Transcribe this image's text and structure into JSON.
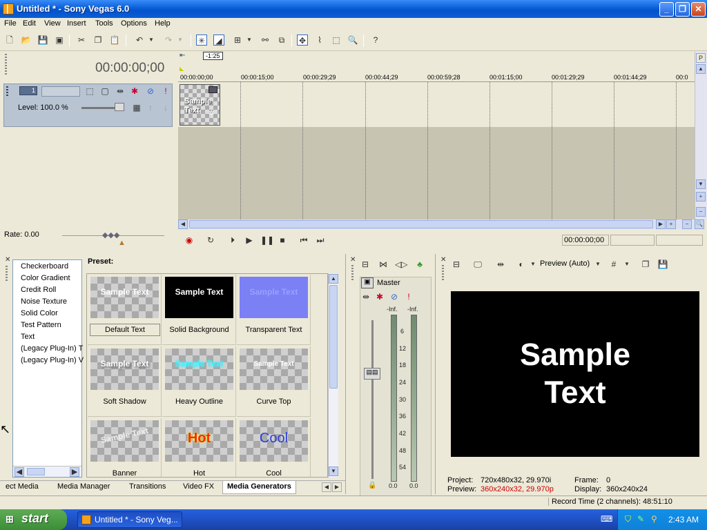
{
  "window": {
    "title": "Untitled * - Sony Vegas 6.0",
    "min": "_",
    "max": "❐",
    "close": "✕"
  },
  "menu": [
    "File",
    "Edit",
    "View",
    "Insert",
    "Tools",
    "Options",
    "Help"
  ],
  "cursor_time": "00:00:00;00",
  "ruler_marker": "-1:25",
  "ruler_labels": [
    "00:00:00;00",
    "00:00:15;00",
    "00:00:29;29",
    "00:00:44;29",
    "00:00:59;28",
    "00:01:15;00",
    "00:01:29;29",
    "00:01:44;29",
    "00:0"
  ],
  "track": {
    "number": "1",
    "level": "Level: 100.0 %"
  },
  "clip": {
    "text_line1": "Sample",
    "text_line2": "Text"
  },
  "rate": "Rate: 0.00",
  "transport": {
    "time": "00:00:00;00"
  },
  "generators": [
    "Checkerboard",
    "Color Gradient",
    "Credit Roll",
    "Noise Texture",
    "Solid Color",
    "Test Pattern",
    "Text",
    "(Legacy Plug-In) T",
    "(Legacy Plug-In) V"
  ],
  "preset_label": "Preset:",
  "presets": [
    {
      "label": "Default Text",
      "thumb": "Sample Text",
      "style": "checker",
      "color": "#ffffff"
    },
    {
      "label": "Solid Background",
      "thumb": "Sample Text",
      "style": "black",
      "color": "#ffffff"
    },
    {
      "label": "Transparent Text",
      "thumb": "Sample Text",
      "style": "purple",
      "color": "#9aa0ff"
    },
    {
      "label": "Soft Shadow",
      "thumb": "Sample Text",
      "style": "checker",
      "color": "#ffffff"
    },
    {
      "label": "Heavy Outline",
      "thumb": "Sample Text",
      "style": "checker",
      "color": "#3ff2ff"
    },
    {
      "label": "Curve Top",
      "thumb": "Sample Text",
      "style": "checker",
      "color": "#ffffff"
    },
    {
      "label": "Banner",
      "thumb": "Sample Text",
      "style": "checker",
      "color": "#eeeeee"
    },
    {
      "label": "Hot",
      "thumb": "Hot",
      "style": "checker",
      "color": "#ff2a00"
    },
    {
      "label": "Cool",
      "thumb": "Cool",
      "style": "checker",
      "color": "#2b3fd6"
    }
  ],
  "tabs": [
    "ect Media",
    "Media Manager",
    "Transitions",
    "Video FX",
    "Media Generators"
  ],
  "mixer": {
    "label": "Master",
    "inf_left": "-Inf.",
    "inf_right": "-Inf.",
    "scale": [
      "6",
      "12",
      "18",
      "24",
      "30",
      "36",
      "42",
      "48",
      "54"
    ],
    "val_left": "0.0",
    "val_right": "0.0"
  },
  "preview": {
    "mode": "Preview (Auto)",
    "screen_line1": "Sample",
    "screen_line2": "Text",
    "project_label": "Project:",
    "project_value": "720x480x32, 29.970i",
    "preview_label": "Preview:",
    "preview_value": "360x240x32, 29.970p",
    "frame_label": "Frame:",
    "frame_value": "0",
    "display_label": "Display:",
    "display_value": "360x240x24"
  },
  "status": "Record Time (2 channels): 48:51:10",
  "taskbar": {
    "start": "start",
    "task": "Untitled * - Sony Veg...",
    "clock": "2:43 AM"
  }
}
